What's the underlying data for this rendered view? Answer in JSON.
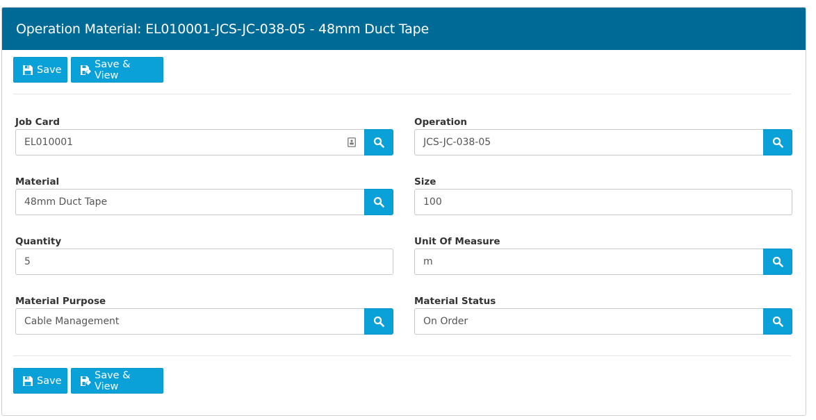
{
  "header": {
    "title": "Operation Material: EL010001-JCS-JC-038-05 - 48mm Duct Tape"
  },
  "toolbar": {
    "save_label": "Save",
    "save_view_label": "Save & View"
  },
  "fields": {
    "job_card": {
      "label": "Job Card",
      "value": "EL010001"
    },
    "operation": {
      "label": "Operation",
      "value": "JCS-JC-038-05"
    },
    "material": {
      "label": "Material",
      "value": "48mm Duct Tape"
    },
    "size": {
      "label": "Size",
      "value": "100"
    },
    "quantity": {
      "label": "Quantity",
      "value": "5"
    },
    "unit_of_measure": {
      "label": "Unit Of Measure",
      "value": "m"
    },
    "material_purpose": {
      "label": "Material Purpose",
      "value": "Cable Management"
    },
    "material_status": {
      "label": "Material Status",
      "value": "On Order"
    }
  },
  "colors": {
    "header_bg": "#006a96",
    "button_bg": "#0aa0d8"
  },
  "icons": {
    "save": "floppy-disk-icon",
    "save_view": "save-and-view-icon",
    "search": "search-icon",
    "contact": "contact-card-icon"
  }
}
